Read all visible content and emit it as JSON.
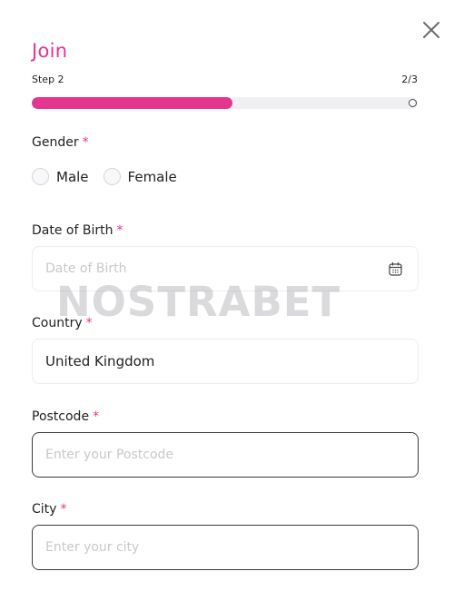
{
  "header": {
    "title": "Join",
    "step_label": "Step 2",
    "step_count": "2/3",
    "progress": 0.52
  },
  "gender": {
    "label": "Gender",
    "required_mark": "*",
    "options": [
      {
        "label": "Male"
      },
      {
        "label": "Female"
      }
    ]
  },
  "dob": {
    "label": "Date of Birth",
    "required_mark": "*",
    "placeholder": "Date of Birth",
    "icon": "calendar-icon"
  },
  "country": {
    "label": "Country",
    "required_mark": "*",
    "value": "United Kingdom"
  },
  "postcode": {
    "label": "Postcode",
    "required_mark": "*",
    "placeholder": "Enter your Postcode"
  },
  "city": {
    "label": "City",
    "required_mark": "*",
    "placeholder": "Enter your city"
  },
  "watermark": "NOSTRABET",
  "colors": {
    "accent": "#e4358f",
    "track": "#f0f0f3"
  }
}
